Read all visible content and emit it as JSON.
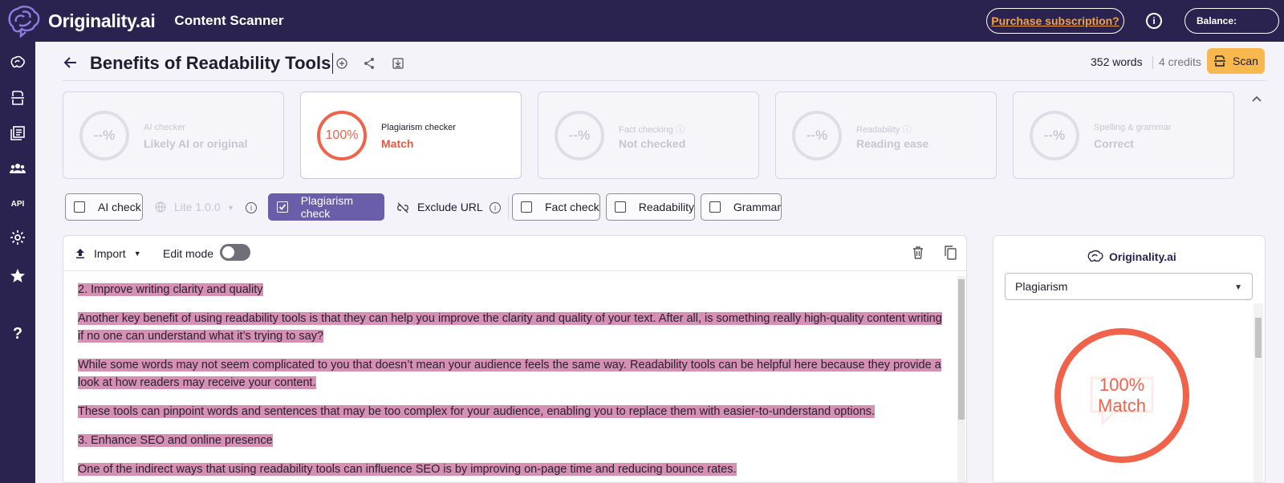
{
  "topbar": {
    "brand": "Originality.ai",
    "app_title": "Content Scanner",
    "purchase_label": "Purchase subscription?",
    "info_glyph": "i",
    "balance_label": "Balance:"
  },
  "sidebar": {
    "items": [
      "brain-icon",
      "scanner-icon",
      "library-icon",
      "team-icon",
      "API",
      "settings-icon",
      "star-icon",
      "?"
    ]
  },
  "document": {
    "title": "Benefits of Readability Tools",
    "words": "352 words",
    "credits": "4 credits",
    "scan_label": "Scan"
  },
  "cards": [
    {
      "ring": "--%",
      "label": "AI checker",
      "value": "Likely AI or original",
      "active": false
    },
    {
      "ring": "100%",
      "label": "Plagiarism checker",
      "value": "Match",
      "active": true
    },
    {
      "ring": "--%",
      "label": "Fact checking ⓘ",
      "value": "Not checked",
      "active": false
    },
    {
      "ring": "--%",
      "label": "Readability ⓘ",
      "value": "Reading ease",
      "active": false
    },
    {
      "ring": "--%",
      "label": "Spelling & grammar",
      "value": "Correct",
      "active": false
    }
  ],
  "toggles": {
    "ai_check": "AI check",
    "model": "Lite 1.0.0",
    "plagiarism_check": "Plagiarism check",
    "exclude_url": "Exclude URL",
    "fact_check": "Fact check",
    "readability": "Readability",
    "grammar": "Grammar",
    "info_glyph": "i"
  },
  "editor": {
    "import_label": "Import",
    "edit_mode_label": "Edit mode",
    "paragraphs": [
      "2.  Improve writing clarity and quality",
      "Another key benefit of using readability tools is that they can help you improve the clarity and quality of your text.  After all, is something really high-quality content writing if no one can understand what it’s trying to say?",
      "While some words may not seem complicated to you that doesn’t mean your audience feels the same way.  Readability tools can be helpful here because they provide a look at how readers may receive your content.",
      "These tools can pinpoint words and sentences that may be too complex for your audience, enabling you to replace them with easier-to-understand options.",
      "3.  Enhance SEO and online presence",
      "One of the indirect ways that using readability tools can influence SEO is by improving on-page time and reducing bounce rates."
    ]
  },
  "panel": {
    "brand": "Originality.ai",
    "select_value": "Plagiarism",
    "score": "100%",
    "score_label": "Match"
  },
  "colors": {
    "nav_bg": "#2a2350",
    "accent": "#f0624a",
    "highlight": "#d690b4",
    "scan": "#f9b84d",
    "chip_on": "#6a5eab"
  }
}
